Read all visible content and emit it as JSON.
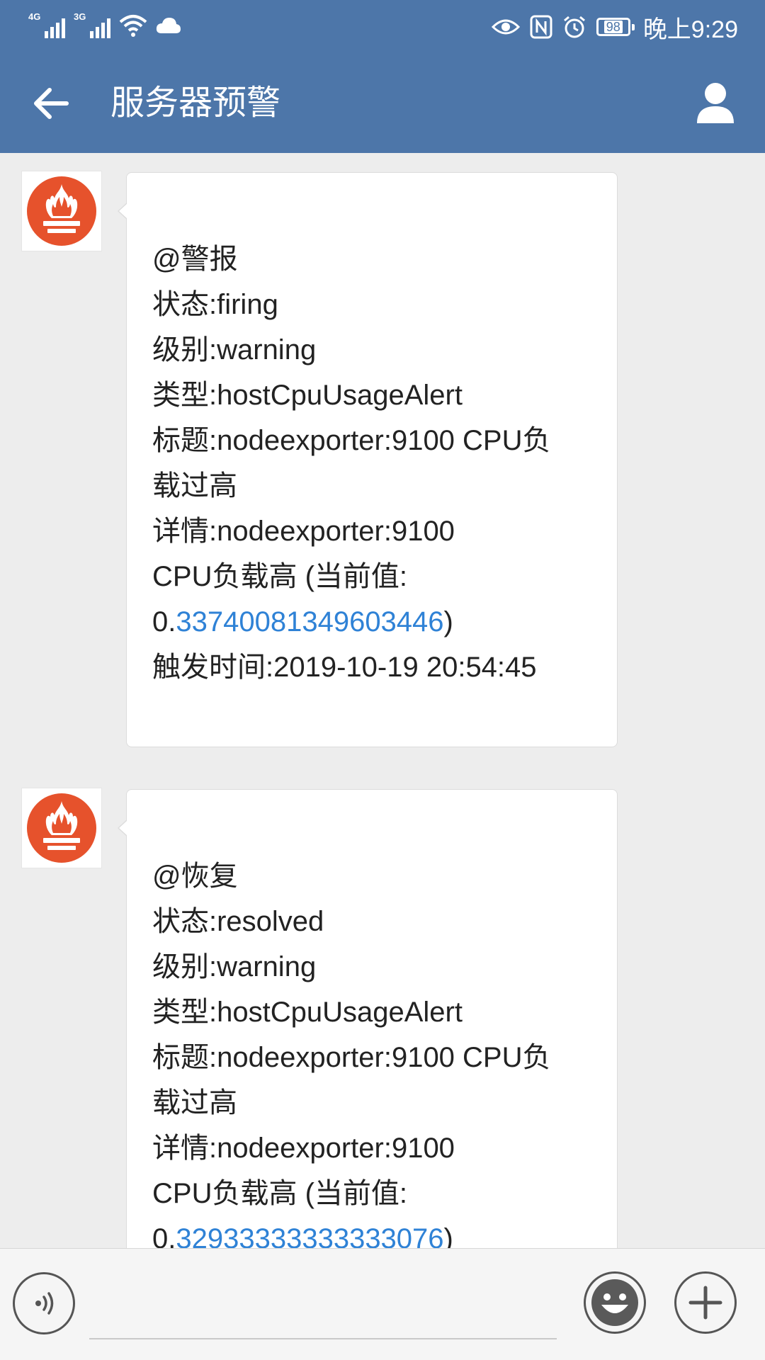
{
  "status_bar": {
    "network_1": "4G",
    "network_2": "3G",
    "battery_level": "98",
    "time": "晚上9:29",
    "icons": [
      "signal-4g-icon",
      "signal-3g-icon",
      "wifi-icon",
      "cloud-icon",
      "eye-comfort-icon",
      "nfc-icon",
      "alarm-icon",
      "battery-icon"
    ]
  },
  "header": {
    "back_icon": "back-arrow-icon",
    "title": "服务器预警",
    "contact_icon": "person-icon"
  },
  "colors": {
    "header_bg": "#4d76a9",
    "chat_bg": "#ededed",
    "link_number": "#2f82d6",
    "avatar_red": "#e6522c"
  },
  "messages": [
    {
      "sender_icon": "prometheus-logo-icon",
      "lines": [
        {
          "text": "@警报"
        },
        {
          "text": "状态:firing"
        },
        {
          "text": "级别:warning"
        },
        {
          "text": "类型:hostCpuUsageAlert"
        },
        {
          "text": "标题:nodeexporter:9100 CPU负"
        },
        {
          "text": "载过高"
        },
        {
          "text": "详情:nodeexporter:9100"
        },
        {
          "text": "CPU负载高 (当前值:"
        },
        {
          "pre": "0.",
          "num": "33740081349603446",
          "post": ")"
        },
        {
          "text": "触发时间:2019-10-19 20:54:45"
        }
      ]
    },
    {
      "sender_icon": "prometheus-logo-icon",
      "lines": [
        {
          "text": "@恢复"
        },
        {
          "text": "状态:resolved"
        },
        {
          "text": "级别:warning"
        },
        {
          "text": "类型:hostCpuUsageAlert"
        },
        {
          "text": "标题:nodeexporter:9100 CPU负"
        },
        {
          "text": "载过高"
        },
        {
          "text": "详情:nodeexporter:9100"
        },
        {
          "text": "CPU负载高 (当前值:"
        },
        {
          "pre": "0.",
          "num": "32933333333333076",
          "post": ")"
        }
      ]
    }
  ],
  "input_bar": {
    "voice_icon": "voice-input-icon",
    "emoji_icon": "emoji-icon",
    "plus_icon": "plus-icon",
    "message_value": ""
  }
}
